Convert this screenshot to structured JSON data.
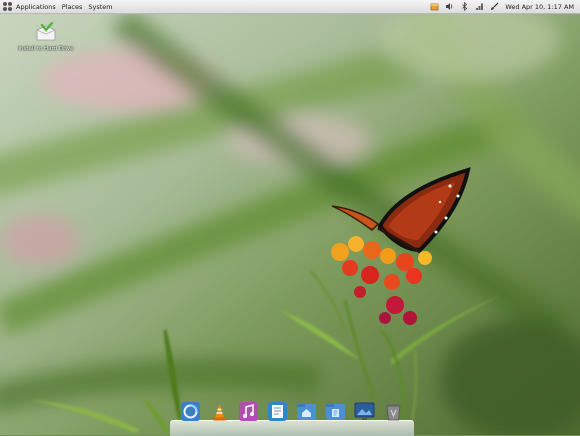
{
  "top_panel": {
    "menus": [
      "Applications",
      "Places",
      "System"
    ],
    "clock": "Wed Apr 10,  1:17 AM"
  },
  "desktop": {
    "icons": [
      {
        "label": "Install to Hard Drive",
        "icon": "installer-icon"
      }
    ]
  },
  "tray_icons": [
    "package-updates-icon",
    "volume-icon",
    "bluetooth-icon",
    "network-icon",
    "brush-icon"
  ],
  "dock": {
    "items": [
      "browser-icon",
      "vlc-icon",
      "music-player-icon",
      "text-editor-icon",
      "home-folder-icon",
      "documents-folder-icon",
      "desktop-settings-icon",
      "trash-icon"
    ]
  },
  "colors": {
    "panel": "#e8e8e8",
    "accent_blue": "#3a7fc2"
  }
}
